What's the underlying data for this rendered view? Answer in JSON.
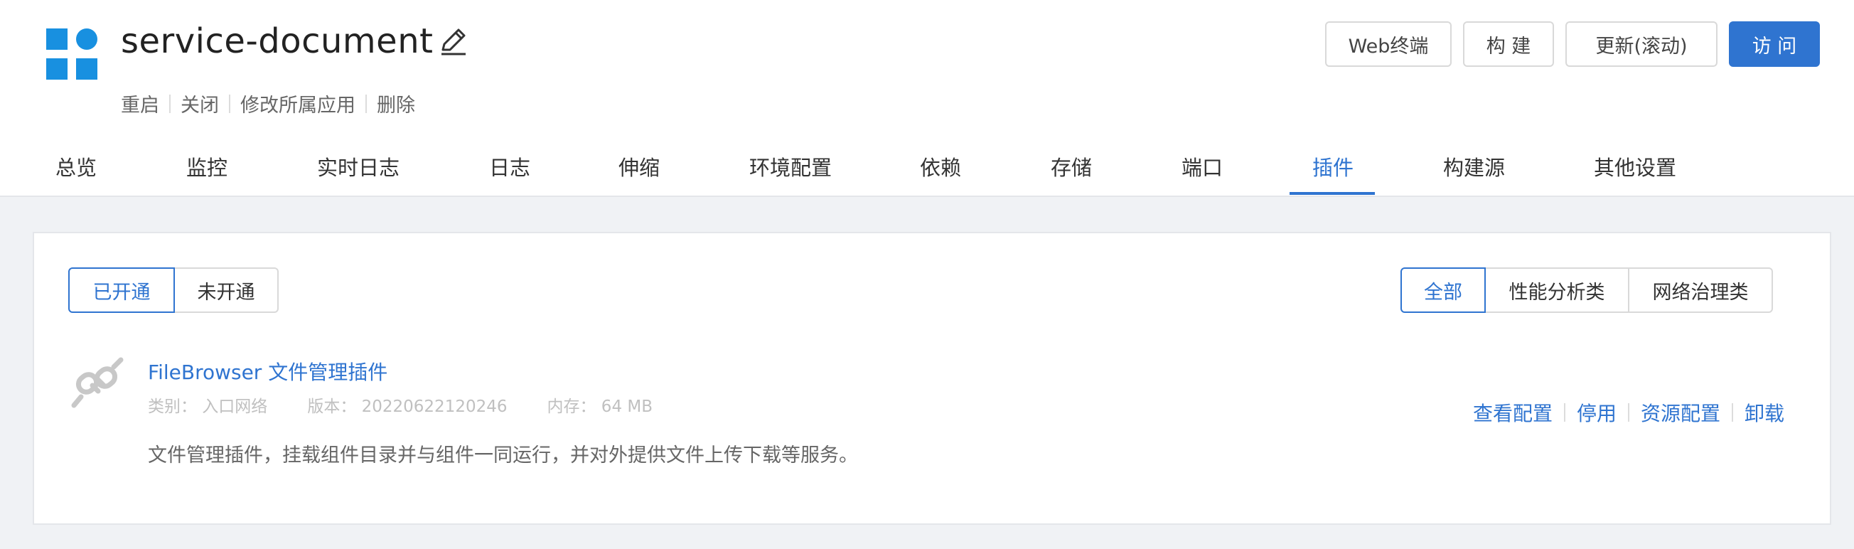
{
  "app": {
    "name": "service-document"
  },
  "actions": [
    "重启",
    "关闭",
    "修改所属应用",
    "删除"
  ],
  "toolbar": {
    "web_terminal": "Web终端",
    "build": "构 建",
    "update": "更新(滚动)",
    "visit": "访 问"
  },
  "tabs": [
    "总览",
    "监控",
    "实时日志",
    "日志",
    "伸缩",
    "环境配置",
    "依赖",
    "存储",
    "端口",
    "插件",
    "构建源",
    "其他设置"
  ],
  "active_tab": "插件",
  "plugin_status_filter": {
    "enabled": "已开通",
    "disabled": "未开通",
    "selected": "已开通"
  },
  "plugin_category_filter": {
    "all": "全部",
    "performance": "性能分析类",
    "network": "网络治理类",
    "selected": "全部"
  },
  "plugin": {
    "name": "FileBrowser 文件管理插件",
    "category": "类别： 入口网络",
    "version": "版本： 20220622120246",
    "memory": "内存： 64 MB",
    "description": "文件管理插件，挂载组件目录并与组件一同运行，并对外提供文件上传下载等服务。",
    "ops": {
      "view_config": "查看配置",
      "disable": "停用",
      "resource_config": "资源配置",
      "uninstall": "卸载"
    }
  },
  "colors": {
    "accent": "#2f74d0",
    "logo": "#1890e0"
  }
}
